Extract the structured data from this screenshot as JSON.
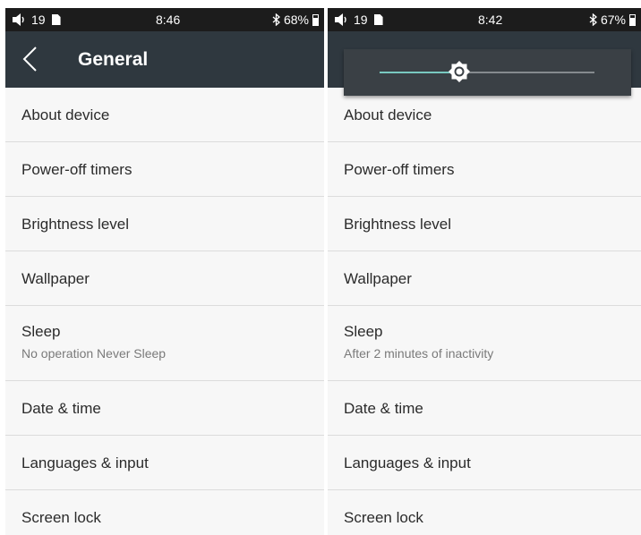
{
  "left_screen": {
    "status": {
      "volume": "19",
      "time": "8:46",
      "battery": "68%"
    },
    "title": "General",
    "items": [
      {
        "label": "About device"
      },
      {
        "label": "Power-off timers"
      },
      {
        "label": "Brightness level"
      },
      {
        "label": "Wallpaper"
      },
      {
        "label": "Sleep",
        "sub": "No operation Never Sleep"
      },
      {
        "label": "Date & time"
      },
      {
        "label": "Languages & input"
      },
      {
        "label": "Screen lock"
      }
    ]
  },
  "right_screen": {
    "status": {
      "volume": "19",
      "time": "8:42",
      "battery": "67%"
    },
    "brightness_level": 0.37,
    "items": [
      {
        "label": "About device"
      },
      {
        "label": "Power-off timers"
      },
      {
        "label": "Brightness level"
      },
      {
        "label": "Wallpaper"
      },
      {
        "label": "Sleep",
        "sub": "After 2 minutes of inactivity"
      },
      {
        "label": "Date & time"
      },
      {
        "label": "Languages & input"
      },
      {
        "label": "Screen lock"
      }
    ]
  },
  "colors": {
    "status_bar": "#1c1c1c",
    "app_bar": "#2f383f",
    "slider_accent": "#79c9c0",
    "popup": "#3a4045"
  }
}
